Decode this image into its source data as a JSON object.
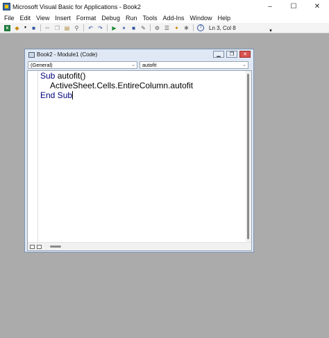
{
  "window": {
    "title": "Microsoft Visual Basic for Applications - Book2",
    "controls": [
      "–",
      "☐",
      "✕"
    ]
  },
  "menu": [
    "File",
    "Edit",
    "View",
    "Insert",
    "Format",
    "Debug",
    "Run",
    "Tools",
    "Add-Ins",
    "Window",
    "Help"
  ],
  "toolbar": {
    "status": "Ln 3, Col 8"
  },
  "code_window": {
    "title": "Book2 - Module1 (Code)",
    "object_combo": "(General)",
    "procedure_combo": "autofit",
    "lines": {
      "line1_kw": "Sub",
      "line1_rest": " autofit()",
      "line2": "ActiveSheet.Cells.EntireColumn.autofit",
      "line3_kw": "End Sub"
    }
  }
}
